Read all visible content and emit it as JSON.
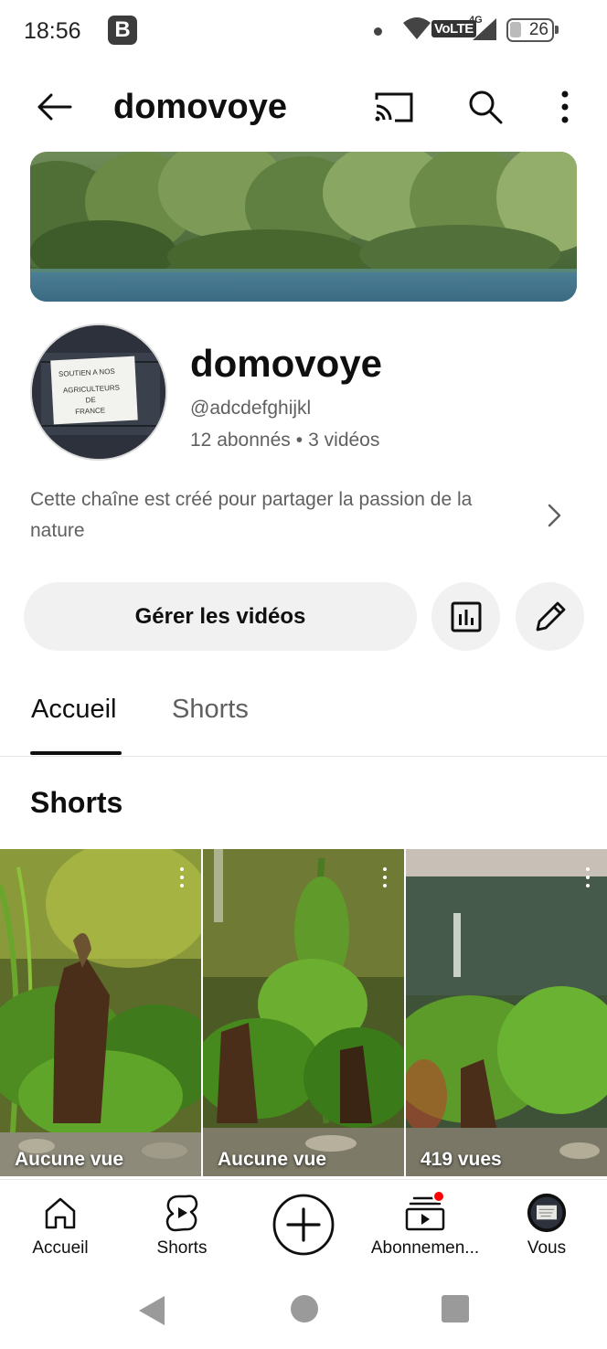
{
  "status_bar": {
    "time": "18:56",
    "app_badge": "B",
    "network_label": "VoLTE",
    "network_gen": "4G",
    "battery": "26"
  },
  "topbar": {
    "title": "domovoye",
    "icons": [
      "back-arrow-icon",
      "cast-icon",
      "search-icon",
      "more-vert-icon"
    ]
  },
  "channel": {
    "name": "domovoye",
    "handle": "@adcdefghijkl",
    "subscribers": "12 abonnés",
    "separator": "•",
    "videos": "3 vidéos",
    "description": "Cette chaîne est créé pour partager la passion de la nature",
    "avatar_sign_text": "SOUTIEN A NOS AGRICULTEURS DE FRANCE"
  },
  "actions": {
    "manage_label": "Gérer les vidéos"
  },
  "tabs": [
    {
      "label": "Accueil",
      "active": true
    },
    {
      "label": "Shorts",
      "active": false
    }
  ],
  "section": {
    "title": "Shorts"
  },
  "shorts": [
    {
      "views": "Aucune vue"
    },
    {
      "views": "Aucune vue"
    },
    {
      "views": "419 vues"
    }
  ],
  "bottom_nav": [
    {
      "label": "Accueil",
      "icon": "home-icon"
    },
    {
      "label": "Shorts",
      "icon": "shorts-icon"
    },
    {
      "label": "",
      "icon": "create-plus-icon"
    },
    {
      "label": "Abonnemen...",
      "icon": "subscriptions-icon",
      "notification": true
    },
    {
      "label": "Vous",
      "icon": "avatar-icon"
    }
  ],
  "colors": {
    "text_primary": "#0f0f0f",
    "text_secondary": "#606060",
    "button_bg": "#f1f1f1",
    "notification": "#ff0000"
  }
}
